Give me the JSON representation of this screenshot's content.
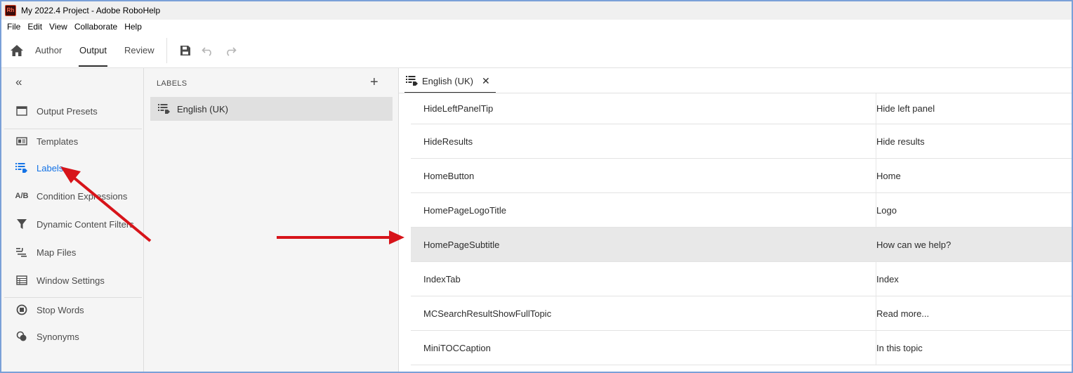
{
  "window": {
    "title": "My 2022.4 Project - Adobe RoboHelp",
    "logo_text": "Rh"
  },
  "menu": [
    "File",
    "Edit",
    "View",
    "Collaborate",
    "Help"
  ],
  "toolbar": {
    "tabs": [
      {
        "label": "Author",
        "active": false
      },
      {
        "label": "Output",
        "active": true
      },
      {
        "label": "Review",
        "active": false
      }
    ]
  },
  "leftnav": {
    "collapse_glyph": "«",
    "items": [
      {
        "label": "Output Presets",
        "icon": "output-presets-icon"
      },
      {
        "label": "Templates",
        "icon": "templates-icon"
      },
      {
        "label": "Labels",
        "icon": "labels-icon",
        "active": true
      },
      {
        "label": "Condition Expressions",
        "icon": "condition-expressions-icon",
        "icon_text": "A/B"
      },
      {
        "label": "Dynamic Content Filters",
        "icon": "filter-icon"
      },
      {
        "label": "Map Files",
        "icon": "map-files-icon"
      },
      {
        "label": "Window Settings",
        "icon": "window-settings-icon"
      },
      {
        "label": "Stop Words",
        "icon": "stop-words-icon"
      },
      {
        "label": "Synonyms",
        "icon": "synonyms-icon"
      }
    ]
  },
  "labels_panel": {
    "header": "LABELS",
    "items": [
      {
        "label": "English (UK)",
        "selected": true
      }
    ]
  },
  "editor": {
    "tab_label": "English (UK)",
    "rows": [
      {
        "key": "HideLeftPanelTip",
        "value": "Hide left panel"
      },
      {
        "key": "HideResults",
        "value": "Hide results"
      },
      {
        "key": "HomeButton",
        "value": "Home"
      },
      {
        "key": "HomePageLogoTitle",
        "value": "Logo"
      },
      {
        "key": "HomePageSubtitle",
        "value": "How can we help?",
        "highlighted": true
      },
      {
        "key": "IndexTab",
        "value": "Index"
      },
      {
        "key": "MCSearchResultShowFullTopic",
        "value": "Read more..."
      },
      {
        "key": "MiniTOCCaption",
        "value": "In this topic"
      }
    ]
  },
  "colors": {
    "accent": "#1473e6",
    "annotation_arrow": "#d7141a",
    "window_border": "#7aa0d8"
  }
}
